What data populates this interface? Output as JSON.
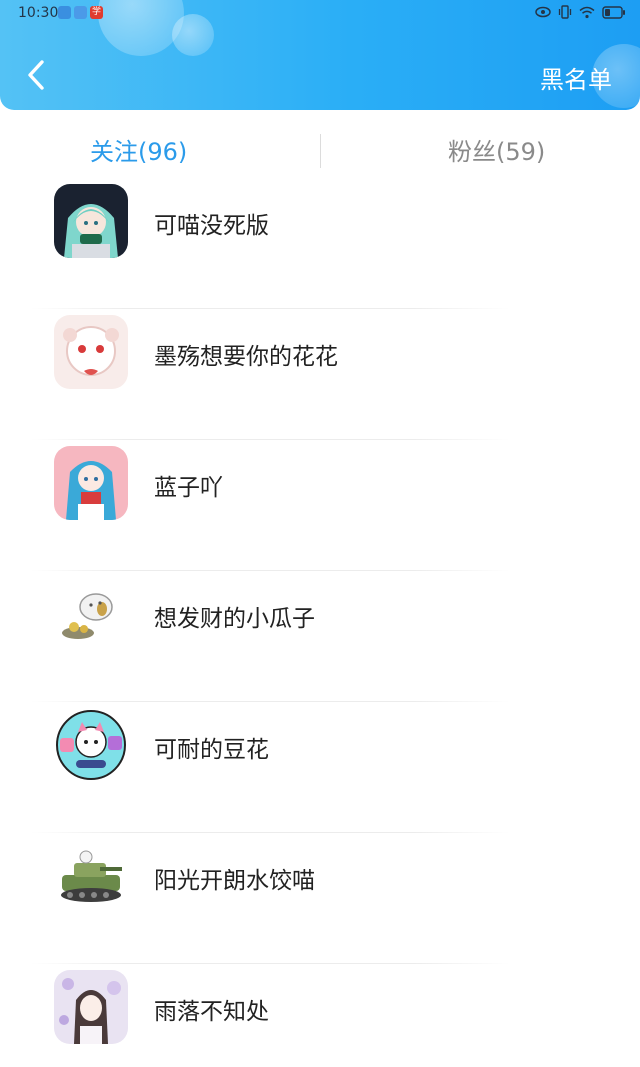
{
  "status_bar": {
    "time": "10:30",
    "app_icons": [
      "#3a8fe0",
      "#4b9ae8",
      "#e03b2e"
    ],
    "app_icon_text": "学"
  },
  "header": {
    "blacklist_label": "黑名单",
    "back_icon": "chevron-left-icon"
  },
  "tabs": [
    {
      "label": "关注(96)",
      "active": true
    },
    {
      "label": "粉丝(59)",
      "active": false
    }
  ],
  "follow_list": [
    {
      "name": "可喵没死版"
    },
    {
      "name": "墨殇想要你的花花"
    },
    {
      "name": "蓝子吖"
    },
    {
      "name": "想发财的小瓜子"
    },
    {
      "name": "可耐的豆花"
    },
    {
      "name": "阳光开朗水饺喵"
    },
    {
      "name": "雨落不知处"
    }
  ],
  "colors": {
    "header_start": "#54c2f5",
    "header_end": "#1d9ef3",
    "active_tab": "#2b9bea",
    "inactive_tab": "#8a8a8a"
  }
}
